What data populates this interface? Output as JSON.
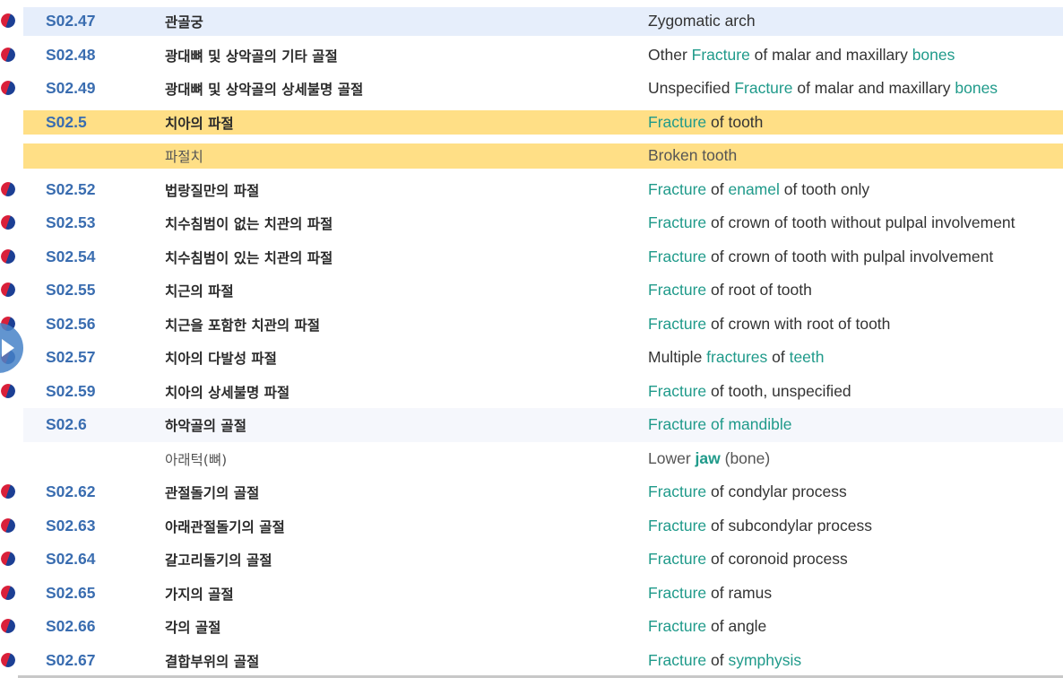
{
  "rows": [
    {
      "code": "S02.47",
      "ko": "관골궁",
      "flag": true,
      "style": "first",
      "en": [
        {
          "t": "Zygomatic arch"
        }
      ]
    },
    {
      "code": "S02.48",
      "ko": "광대뼈 및 상악골의 기타 골절",
      "flag": true,
      "en": [
        {
          "t": "Other "
        },
        {
          "t": "Fracture",
          "kw": true
        },
        {
          "t": " of malar and maxillary "
        },
        {
          "t": "bones",
          "kw": true
        }
      ]
    },
    {
      "code": "S02.49",
      "ko": "광대뼈 및 상악골의 상세불명 골절",
      "flag": true,
      "en": [
        {
          "t": "Unspecified "
        },
        {
          "t": "Fracture",
          "kw": true
        },
        {
          "t": " of malar and maxillary "
        },
        {
          "t": "bones",
          "kw": true
        }
      ]
    },
    {
      "code": "S02.5",
      "ko": "치아의 파절",
      "flag": false,
      "style": "hl",
      "en": [
        {
          "t": "Fracture",
          "kw": true
        },
        {
          "t": " of tooth"
        }
      ]
    },
    {
      "code": "",
      "ko": "파절치",
      "flag": false,
      "style": "hl",
      "syn": true,
      "en": [
        {
          "t": "Broken tooth"
        }
      ]
    },
    {
      "code": "S02.52",
      "ko": "법랑질만의 파절",
      "flag": true,
      "en": [
        {
          "t": "Fracture",
          "kw": true
        },
        {
          "t": " of "
        },
        {
          "t": "enamel",
          "kw": true
        },
        {
          "t": " of tooth only"
        }
      ]
    },
    {
      "code": "S02.53",
      "ko": "치수침범이 없는 치관의 파절",
      "flag": true,
      "en": [
        {
          "t": "Fracture",
          "kw": true
        },
        {
          "t": " of crown of tooth without pulpal involvement"
        }
      ]
    },
    {
      "code": "S02.54",
      "ko": "치수침범이 있는 치관의 파절",
      "flag": true,
      "en": [
        {
          "t": "Fracture",
          "kw": true
        },
        {
          "t": " of crown of tooth with pulpal involvement"
        }
      ]
    },
    {
      "code": "S02.55",
      "ko": "치근의 파절",
      "flag": true,
      "en": [
        {
          "t": "Fracture",
          "kw": true
        },
        {
          "t": " of root of tooth"
        }
      ]
    },
    {
      "code": "S02.56",
      "ko": "치근을 포함한 치관의 파절",
      "flag": true,
      "en": [
        {
          "t": "Fracture",
          "kw": true
        },
        {
          "t": " of crown with root of tooth"
        }
      ]
    },
    {
      "code": "S02.57",
      "ko": "치아의 다발성 파절",
      "flag": true,
      "en": [
        {
          "t": "Multiple "
        },
        {
          "t": "fractures",
          "kw": true
        },
        {
          "t": " of "
        },
        {
          "t": "teeth",
          "kw": true
        }
      ]
    },
    {
      "code": "S02.59",
      "ko": "치아의 상세불명 파절",
      "flag": true,
      "en": [
        {
          "t": "Fracture",
          "kw": true
        },
        {
          "t": " of tooth, unspecified"
        }
      ]
    },
    {
      "code": "S02.6",
      "ko": "하악골의 골절",
      "flag": false,
      "style": "ws",
      "en": [
        {
          "t": "Fracture of mandible",
          "kw": true
        }
      ]
    },
    {
      "code": "",
      "ko": "아래턱(뼈)",
      "flag": false,
      "syn": true,
      "en": [
        {
          "t": "Lower "
        },
        {
          "t": "jaw",
          "kwb": true
        },
        {
          "t": " (bone)"
        }
      ]
    },
    {
      "code": "S02.62",
      "ko": "관절돌기의 골절",
      "flag": true,
      "en": [
        {
          "t": "Fracture",
          "kw": true
        },
        {
          "t": " of condylar process"
        }
      ]
    },
    {
      "code": "S02.63",
      "ko": "아래관절돌기의 골절",
      "flag": true,
      "en": [
        {
          "t": "Fracture",
          "kw": true
        },
        {
          "t": " of subcondylar process"
        }
      ]
    },
    {
      "code": "S02.64",
      "ko": "갈고리돌기의 골절",
      "flag": true,
      "en": [
        {
          "t": "Fracture",
          "kw": true
        },
        {
          "t": " of coronoid process"
        }
      ]
    },
    {
      "code": "S02.65",
      "ko": "가지의 골절",
      "flag": true,
      "en": [
        {
          "t": "Fracture",
          "kw": true
        },
        {
          "t": " of ramus"
        }
      ]
    },
    {
      "code": "S02.66",
      "ko": "각의 골절",
      "flag": true,
      "en": [
        {
          "t": "Fracture",
          "kw": true
        },
        {
          "t": " of angle"
        }
      ]
    },
    {
      "code": "S02.67",
      "ko": "결합부위의 골절",
      "flag": true,
      "en": [
        {
          "t": "Fracture",
          "kw": true
        },
        {
          "t": " of "
        },
        {
          "t": "symphysis",
          "kw": true
        }
      ]
    }
  ],
  "colors": {
    "keyword": "#1f9a8a",
    "code": "#3a6db0",
    "highlight": "#ffdf86"
  },
  "icons": {
    "flag": "korean-flag-icon",
    "play": "play-icon"
  }
}
